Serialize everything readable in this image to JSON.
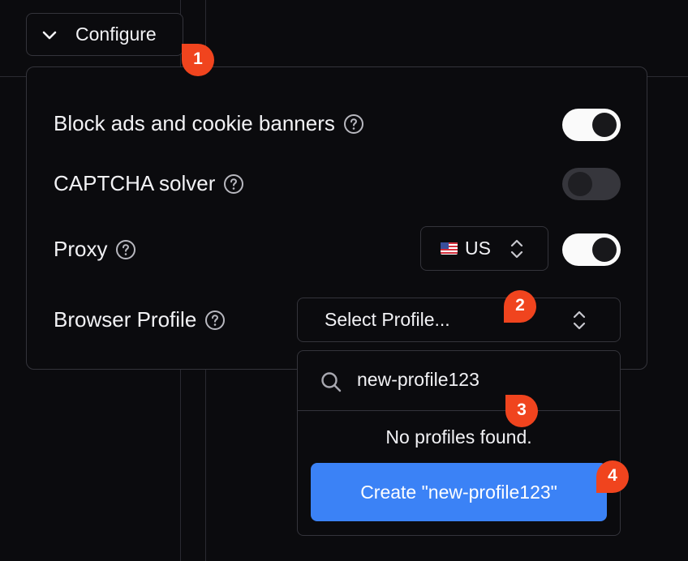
{
  "configure": {
    "label": "Configure",
    "icon": "chevron-down-icon"
  },
  "settings": {
    "block_ads": {
      "label": "Block ads and cookie banners",
      "enabled": true
    },
    "captcha": {
      "label": "CAPTCHA solver",
      "enabled": false
    },
    "proxy": {
      "label": "Proxy",
      "enabled": true,
      "country": "US",
      "flag_icon": "us-flag-icon"
    },
    "browser_profile": {
      "label": "Browser Profile",
      "placeholder": "Select Profile..."
    }
  },
  "profile_dropdown": {
    "search_value": "new-profile123",
    "empty_message": "No profiles found.",
    "create_label": "Create \"new-profile123\""
  },
  "markers": [
    "1",
    "2",
    "3",
    "4"
  ],
  "colors": {
    "background": "#0b0b0e",
    "border": "#34343b",
    "accent": "#3b82f6",
    "marker": "#f0441e",
    "toggle_on": "#fafafa",
    "toggle_off": "#36363c"
  }
}
